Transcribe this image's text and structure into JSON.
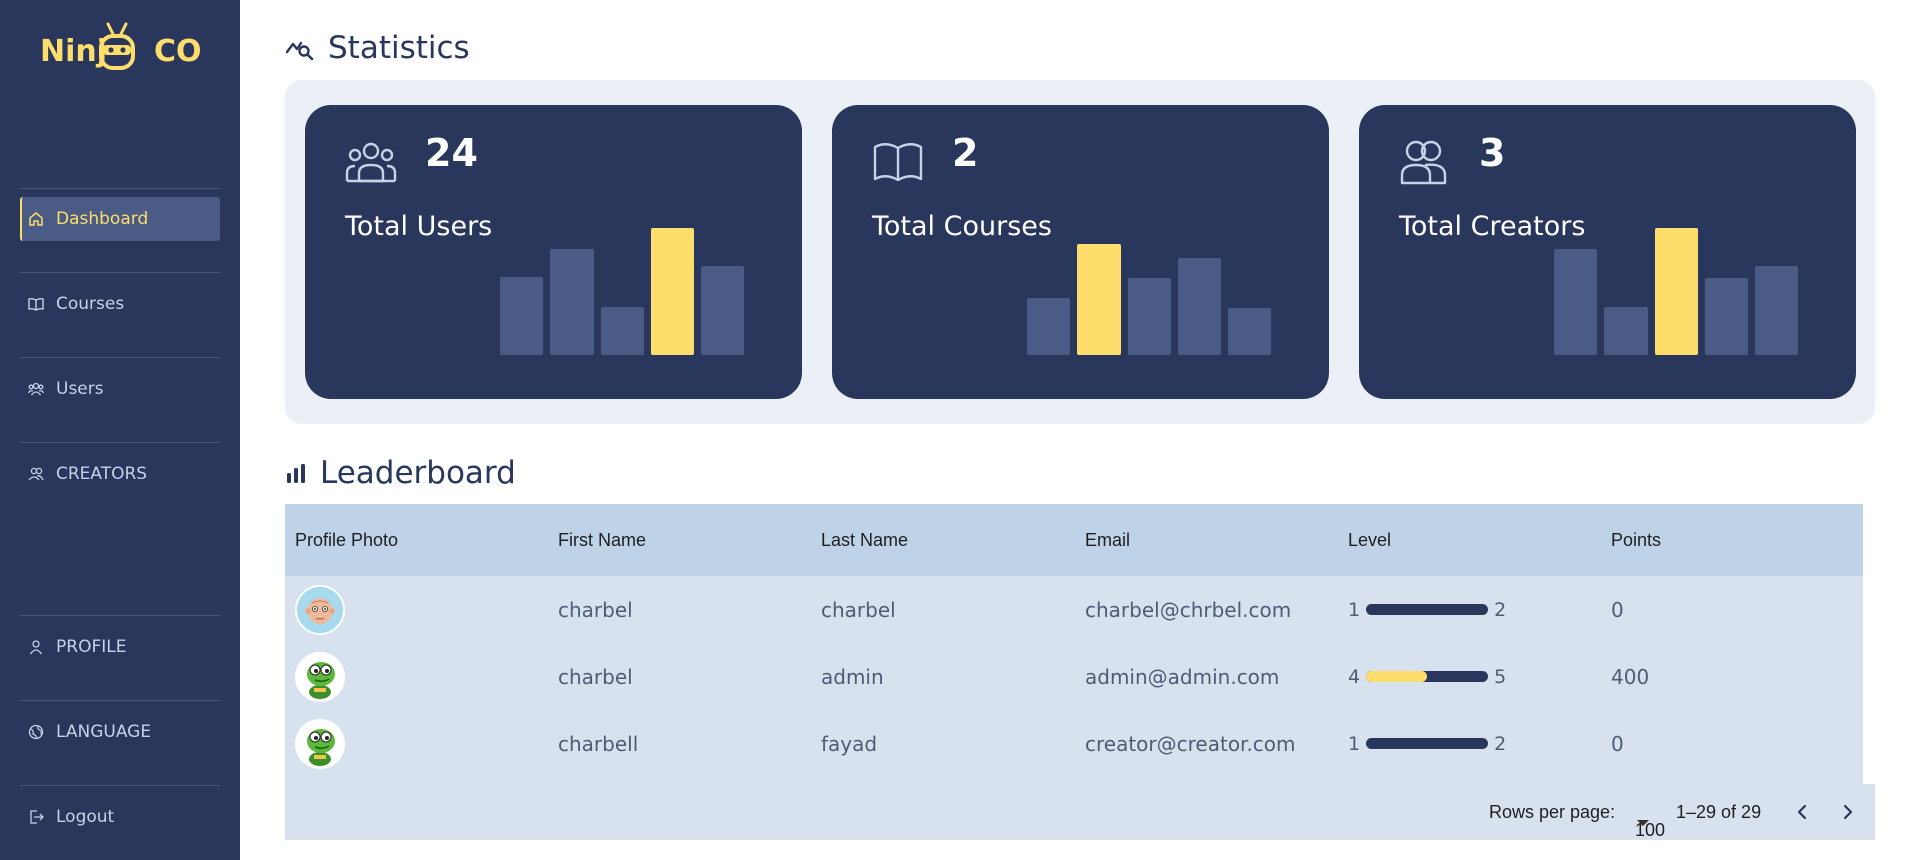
{
  "brand": {
    "logo_left": "Ninj",
    "logo_right": "CO",
    "accent": "#fddd6b",
    "navy": "#28375b"
  },
  "sidebar": {
    "items": [
      {
        "label": "Dashboard",
        "icon": "home-icon",
        "active": true
      },
      {
        "label": "Courses",
        "icon": "book-icon"
      },
      {
        "label": "Users",
        "icon": "users-icon"
      },
      {
        "label": "CREATORS",
        "icon": "creators-icon"
      },
      {
        "label": "PROFILE",
        "icon": "user-icon"
      },
      {
        "label": "LANGUAGE",
        "icon": "globe-icon"
      },
      {
        "label": "Logout",
        "icon": "logout-icon"
      }
    ]
  },
  "statistics": {
    "title": "Statistics",
    "cards": [
      {
        "value": "24",
        "label": "Total Users",
        "icon": "users-group-icon"
      },
      {
        "value": "2",
        "label": "Total Courses",
        "icon": "open-book-icon"
      },
      {
        "value": "3",
        "label": "Total Creators",
        "icon": "two-users-icon"
      }
    ]
  },
  "leaderboard": {
    "title": "Leaderboard",
    "columns": [
      "Profile Photo",
      "First Name",
      "Last Name",
      "Email",
      "Level",
      "Points"
    ],
    "rows": [
      {
        "avatar": "bald-avatar",
        "first_name": "charbel",
        "last_name": "charbel",
        "email": "charbel@chrbel.com",
        "level_from": "1",
        "level_to": "2",
        "level_progress": 0,
        "points": "0"
      },
      {
        "avatar": "turtle-avatar",
        "first_name": "charbel",
        "last_name": "admin",
        "email": "admin@admin.com",
        "level_from": "4",
        "level_to": "5",
        "level_progress": 0.5,
        "points": "400"
      },
      {
        "avatar": "turtle-avatar",
        "first_name": "charbell",
        "last_name": "fayad",
        "email": "creator@creator.com",
        "level_from": "1",
        "level_to": "2",
        "level_progress": 0,
        "points": "0"
      }
    ],
    "footer": {
      "rows_per_page_label": "Rows per page:",
      "rows_per_page_value": "100",
      "range": "1–29 of 29"
    }
  }
}
